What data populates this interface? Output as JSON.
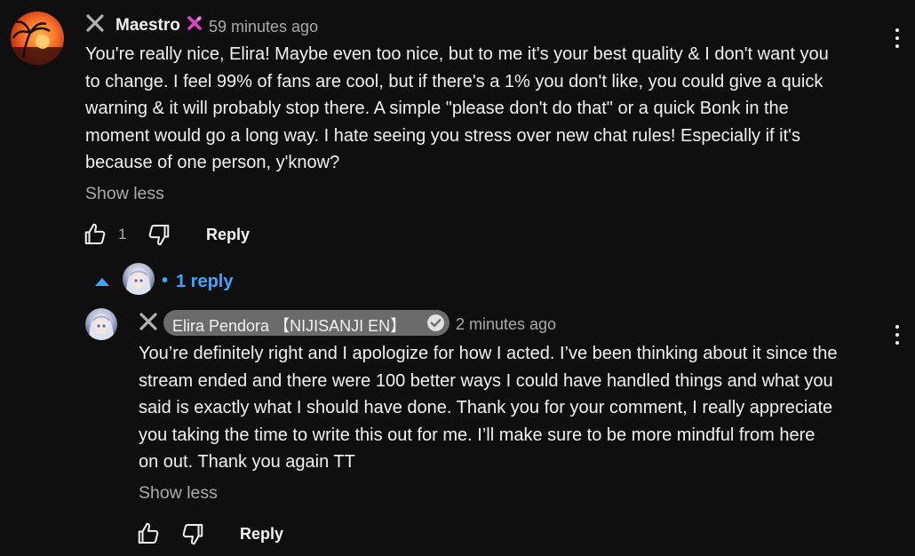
{
  "top_comment": {
    "author": "Maestro",
    "timestamp": "59 minutes ago",
    "text_lines": [
      "You're really nice, Elira! Maybe even too nice, but to me it's your best quality & I don't want you",
      "to change. I feel 99% of fans are cool, but if there's a 1% you don't like, you could give a quick",
      "warning & it will probably stop there. A simple \"please don't do that\" or a quick Bonk in the",
      "moment would go a long way. I hate seeing you stress over new chat rules! Especially if it's",
      "because of one person, y'know?"
    ],
    "show_less": "Show less",
    "like_count": "1",
    "reply_label": "Reply"
  },
  "replies_toggle": {
    "separator": "•",
    "label": "1 reply"
  },
  "reply_comment": {
    "author": "Elira Pendora 【NIJISANJI EN】",
    "timestamp": "2 minutes ago",
    "text_lines": [
      "You’re definitely right and I apologize for how I acted. I’ve been thinking about it since the",
      "stream ended and there were 100 better ways I could have handled things and what you",
      "said is exactly what I should have done. Thank you for your comment, I really appreciate",
      "you taking the time to write this out for me. I’ll make sure to be more mindful from here",
      "on out. Thank you again TT"
    ],
    "show_less": "Show less",
    "reply_label": "Reply"
  },
  "colors": {
    "background": "#0f0f0f",
    "text": "#f1f1f1",
    "secondary_text": "#aaaaaa",
    "link_blue": "#3ea6ff",
    "badge_bg": "#6b6b6b",
    "pink_badge": "#e040c8"
  },
  "icons": {
    "dismiss": "close-icon",
    "member_badge": "pink-x-badge-icon",
    "like": "thumbs-up-icon",
    "dislike": "thumbs-down-icon",
    "more": "more-vertical-icon",
    "collapse": "caret-up-icon",
    "verified": "verified-check-icon"
  }
}
